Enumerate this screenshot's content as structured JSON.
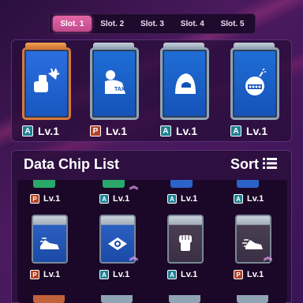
{
  "slots": {
    "tabs": [
      "Slot. 1",
      "Slot. 2",
      "Slot. 3",
      "Slot. 4",
      "Slot. 5"
    ],
    "active_index": 0
  },
  "equipped": [
    {
      "grade": "A",
      "level": "Lv.1",
      "icon": "hand-shield-icon",
      "frame": "gold"
    },
    {
      "grade": "P",
      "level": "Lv.1",
      "icon": "tax-bag-icon",
      "frame": "silver"
    },
    {
      "grade": "A",
      "level": "Lv.1",
      "icon": "hooded-figure-icon",
      "frame": "silver"
    },
    {
      "grade": "A",
      "level": "Lv.1",
      "icon": "bomb-icon",
      "frame": "silver"
    }
  ],
  "chip_list": {
    "title": "Data Chip List",
    "sort_label": "Sort",
    "top_row": [
      {
        "grade": "P",
        "level": "Lv.1",
        "strip_color": "#2aa86a",
        "upgrade": false
      },
      {
        "grade": "A",
        "level": "Lv.1",
        "strip_color": "#2aa86a",
        "upgrade": true
      },
      {
        "grade": "A",
        "level": "Lv.1",
        "strip_color": "#2b63c8",
        "upgrade": false
      },
      {
        "grade": "A",
        "level": "Lv.1",
        "strip_color": "#2b63c8",
        "upgrade": false
      }
    ],
    "main_row": [
      {
        "grade": "P",
        "level": "Lv.1",
        "icon": "running-shoe-icon",
        "style": "blue",
        "upgrade": false
      },
      {
        "grade": "A",
        "level": "Lv.1",
        "icon": "eye-shield-icon",
        "style": "blue",
        "upgrade": true
      },
      {
        "grade": "A",
        "level": "Lv.1",
        "icon": "fist-icon",
        "style": "dark",
        "upgrade": false
      },
      {
        "grade": "P",
        "level": "Lv.1",
        "icon": "speed-shoe-icon",
        "style": "dark",
        "upgrade": true
      }
    ]
  }
}
